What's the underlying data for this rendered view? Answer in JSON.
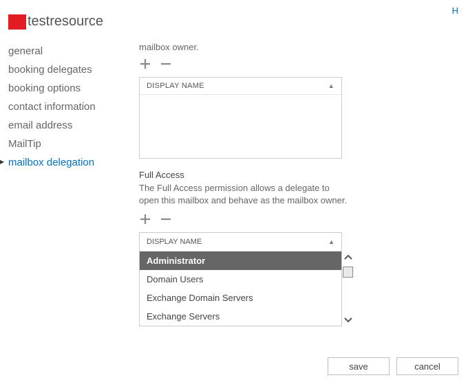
{
  "top_link": "H",
  "header": {
    "title": "testresource"
  },
  "sidebar": {
    "items": [
      {
        "label": "general"
      },
      {
        "label": "booking delegates"
      },
      {
        "label": "booking options"
      },
      {
        "label": "contact information"
      },
      {
        "label": "email address"
      },
      {
        "label": "MailTip"
      },
      {
        "label": "mailbox delegation"
      }
    ],
    "active_index": 6
  },
  "section1": {
    "label": "mailbox owner.",
    "column_header": "DISPLAY NAME"
  },
  "section2": {
    "title": "Full Access",
    "description": "The Full Access permission allows a delegate to open this mailbox and behave as the mailbox owner.",
    "column_header": "DISPLAY NAME",
    "rows": [
      "Administrator",
      "Domain Users",
      "Exchange Domain Servers",
      "Exchange Servers"
    ],
    "selected_index": 0
  },
  "buttons": {
    "save": "save",
    "cancel": "cancel"
  },
  "icons": {
    "plus": "plus-icon",
    "minus": "minus-icon",
    "sort_up": "▲"
  }
}
